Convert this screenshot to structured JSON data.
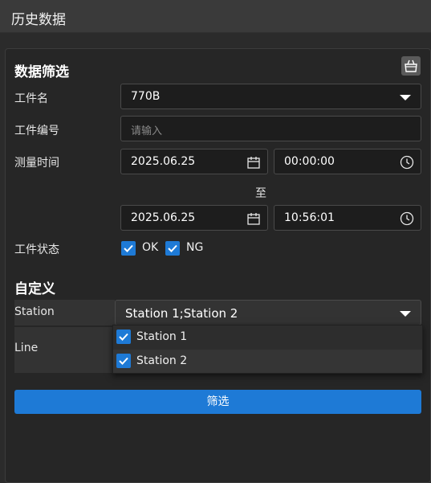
{
  "window": {
    "title": "历史数据"
  },
  "filter": {
    "section_title": "数据筛选",
    "workpiece_name": {
      "label": "工件名",
      "value": "770B"
    },
    "workpiece_number": {
      "label": "工件编号",
      "placeholder": "请输入"
    },
    "measure_time": {
      "label": "测量时间",
      "start_date": "2025.06.25",
      "start_time": "00:00:00",
      "separator": "至",
      "end_date": "2025.06.25",
      "end_time": "10:56:01"
    },
    "status": {
      "label": "工件状态",
      "options": [
        {
          "label": "OK",
          "checked": true
        },
        {
          "label": "NG",
          "checked": true
        }
      ]
    }
  },
  "custom": {
    "section_title": "自定义",
    "station": {
      "label": "Station",
      "value": "Station 1;Station 2",
      "options": [
        {
          "label": "Station 1",
          "checked": true
        },
        {
          "label": "Station 2",
          "checked": true
        }
      ]
    },
    "line": {
      "label": "Line"
    }
  },
  "actions": {
    "filter_button": "筛选"
  },
  "colors": {
    "accent": "#1e7ad6",
    "background": "#262626"
  }
}
